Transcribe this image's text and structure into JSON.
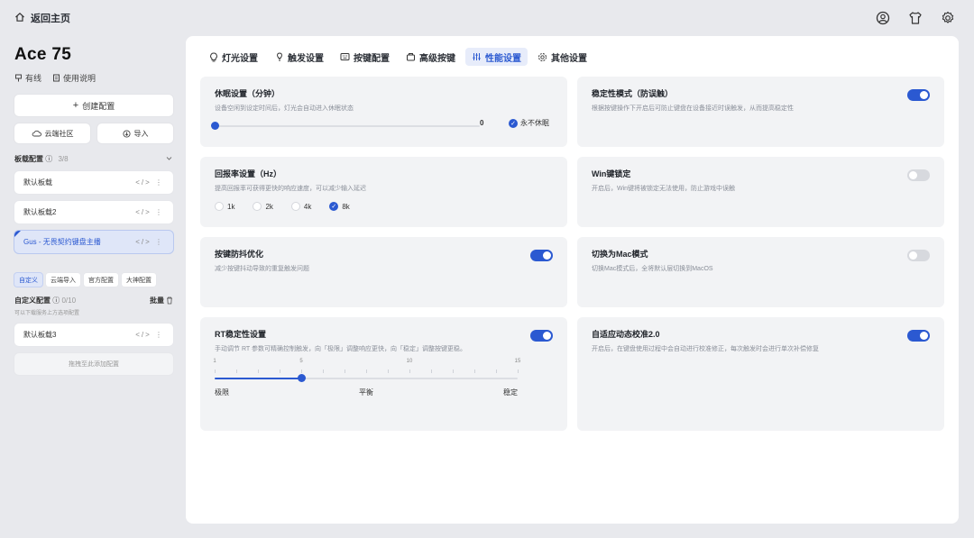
{
  "topbar": {
    "home_label": "返回主页"
  },
  "sidebar": {
    "device_name": "Ace 75",
    "wired_label": "有线",
    "manual_label": "使用说明",
    "create_label": "创建配置",
    "cloud_label": "云端社区",
    "import_label": "导入",
    "board_section_label": "板载配置",
    "board_section_count": "3/8",
    "profiles": [
      {
        "name": "默认板载",
        "ops": "</> ⋮"
      },
      {
        "name": "默认板载2",
        "ops": "</> ⋮"
      },
      {
        "name": "Gus - 无畏契约键盘主播",
        "ops": "</> ⋮"
      }
    ],
    "chips": [
      "自定义",
      "云端导入",
      "官方配置",
      "大神配置"
    ],
    "custom_section_label": "自定义配置",
    "custom_section_count": "0/10",
    "custom_hint": "可以下载服务上方选项配置",
    "custom_action": "批量",
    "custom_profiles": [
      {
        "name": "默认板载3",
        "ops": "</> ⋮"
      }
    ],
    "drop_hint": "拖拽至此添加配置"
  },
  "tabs": [
    {
      "label": "灯光设置",
      "icon": "bulb-icon"
    },
    {
      "label": "触发设置",
      "icon": "pin-icon"
    },
    {
      "label": "按键配置",
      "icon": "keyboard-icon"
    },
    {
      "label": "高级按键",
      "icon": "advanced-key-icon"
    },
    {
      "label": "性能设置",
      "icon": "sliders-icon"
    },
    {
      "label": "其他设置",
      "icon": "gear-icon"
    }
  ],
  "cards": {
    "sleep": {
      "title": "休眠设置（分钟）",
      "desc": "设备空闲到设定时间后，灯光会自动进入休眠状态",
      "value": "0",
      "check_label": "永不休眠",
      "fraction": 0
    },
    "stability": {
      "title": "稳定性模式（防误触）",
      "desc": "根据按键操作下开启后可防止键盘在设备接近时误触发，从而提高稳定性",
      "on": true
    },
    "polling": {
      "title": "回报率设置（Hz）",
      "desc": "提高回报率可获得更快的响应速度，可以减少输入延迟",
      "options": [
        "1k",
        "2k",
        "4k",
        "8k"
      ],
      "selected": "8k"
    },
    "winlock": {
      "title": "Win键锁定",
      "desc": "开启后，Win键将被锁定无法使用，防止游戏中误触",
      "on": false
    },
    "debounce": {
      "title": "按键防抖优化",
      "desc": "减少按键抖动导致的重复触发问题",
      "on": true
    },
    "mac": {
      "title": "切换为Mac模式",
      "desc": "切换Mac模式后，全将默认层切换到MacOS",
      "on": false
    },
    "rt": {
      "title": "RT稳定性设置",
      "desc": "手动调节 RT 参数可精确控制触发，向「极限」调整响应更快，向「稳定」调整按键更稳。",
      "on": true,
      "scale": [
        "1",
        "5",
        "10",
        "15"
      ],
      "scale_min": 1,
      "scale_max": 15,
      "value": 5,
      "labels": [
        "极限",
        "平衡",
        "稳定"
      ]
    },
    "autocal": {
      "title": "自适应动态校准2.0",
      "desc": "开启后，在键盘使用过程中会自动进行校准修正，每次触发时会进行单次补偿修复",
      "on": true
    }
  },
  "colors": {
    "accent": "#2b59d1",
    "card": "#f2f3f5",
    "bg": "#e8e9ed"
  }
}
